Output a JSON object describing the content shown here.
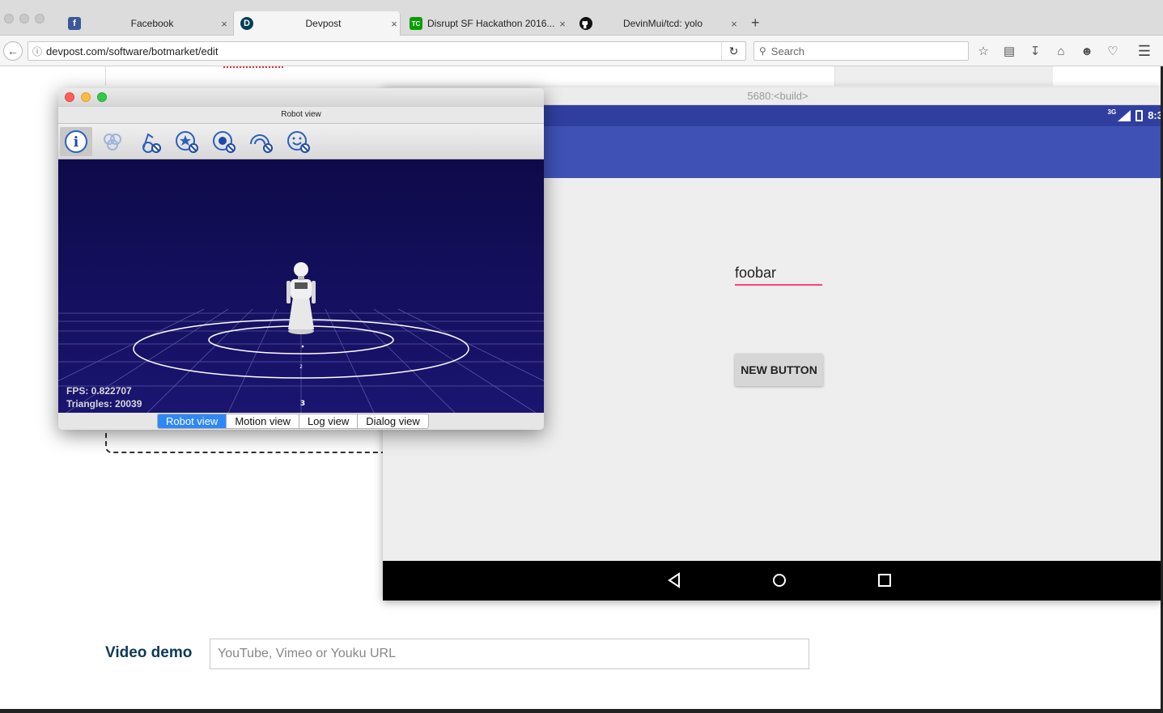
{
  "browser": {
    "tabs": [
      {
        "title": "Facebook",
        "favicon": "f",
        "color": "#3b5998"
      },
      {
        "title": "Devpost",
        "favicon": "D",
        "color": "#003e54"
      },
      {
        "title": "Disrupt SF Hackathon 2016...",
        "favicon": "TC",
        "color": "#0a9e01"
      },
      {
        "title": "DevinMui/tcd: yolo",
        "favicon": "github-icon",
        "color": "#000000"
      }
    ],
    "url": "devpost.com/software/botmarket/edit",
    "search_placeholder": "Search"
  },
  "page": {
    "video_label": "Video demo",
    "video_placeholder": "YouTube, Vimeo or Youku URL"
  },
  "emulator": {
    "title": "5680:<build>",
    "status_time": "8:3",
    "network": "3G",
    "edit_text_value": "foobar",
    "button_label": "NEW BUTTON",
    "colors": {
      "status": "#303f9f",
      "appbar": "#3f51b5",
      "accent": "#ff4081"
    }
  },
  "robot_view": {
    "window_title": "Robot view",
    "toolbar_icons": [
      "info-icon",
      "autonomous-life-icon",
      "robot-arm-disabled-icon",
      "motors-disabled-icon",
      "settings-disabled-icon",
      "awareness-disabled-icon",
      "emotion-disabled-icon"
    ],
    "fps": "FPS: 0.822707",
    "triangles": "Triangles: 20039",
    "tabs": [
      "Robot view",
      "Motion view",
      "Log view",
      "Dialog view"
    ],
    "active_tab": "Robot view"
  }
}
